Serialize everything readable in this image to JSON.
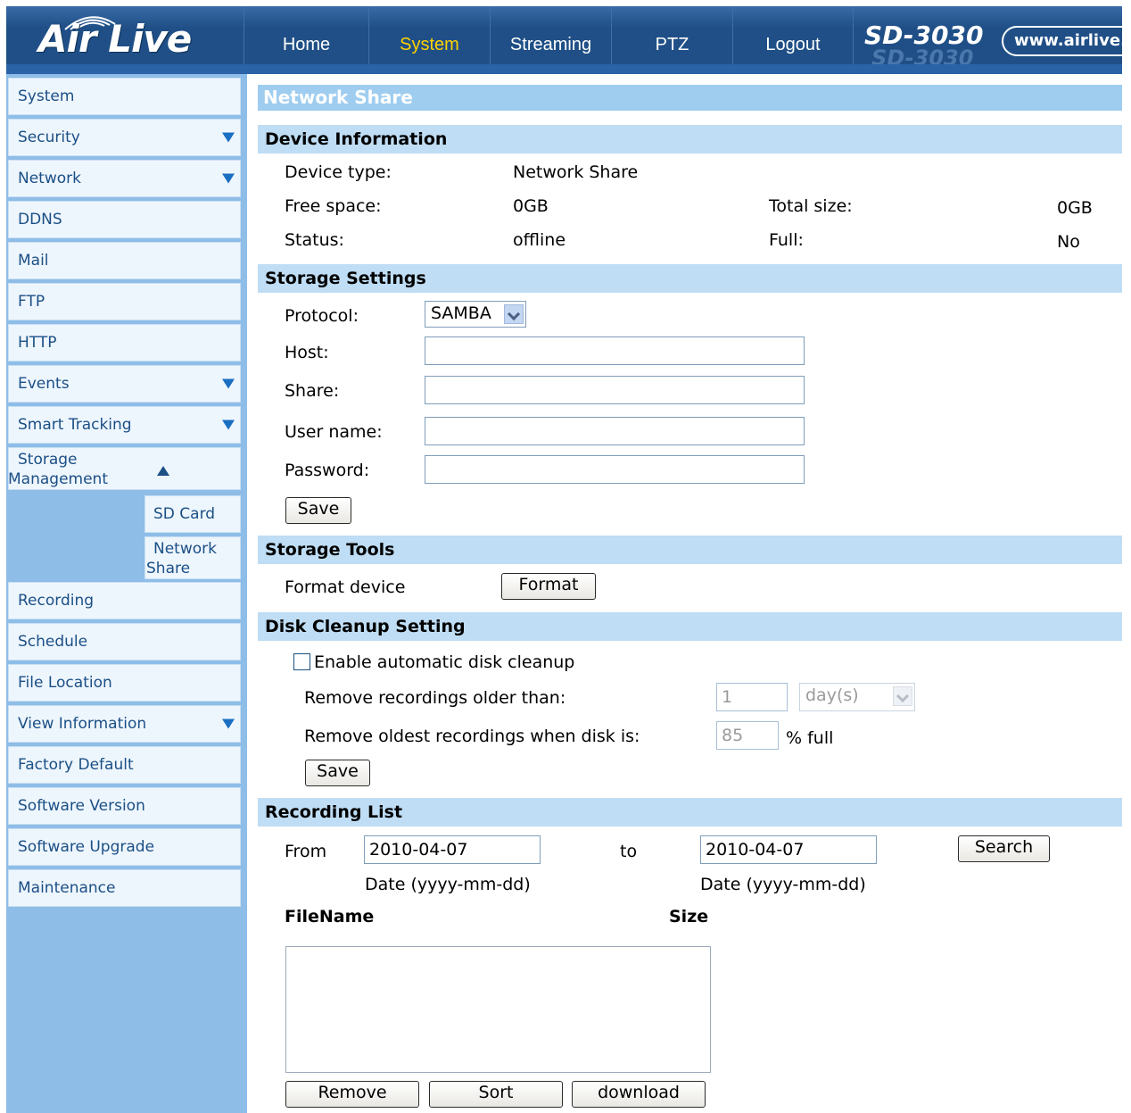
{
  "brand": {
    "logo": "Air Live",
    "model": "SD-3030",
    "url": "www.airlive.c"
  },
  "nav": [
    {
      "label": "Home",
      "active": false
    },
    {
      "label": "System",
      "active": true
    },
    {
      "label": "Streaming",
      "active": false
    },
    {
      "label": "PTZ",
      "active": false
    },
    {
      "label": "Logout",
      "active": false
    }
  ],
  "sidebar": {
    "items": [
      {
        "label": "System"
      },
      {
        "label": "Security",
        "arrow": "down"
      },
      {
        "label": "Network",
        "arrow": "down"
      },
      {
        "label": "DDNS"
      },
      {
        "label": "Mail"
      },
      {
        "label": "FTP"
      },
      {
        "label": "HTTP"
      },
      {
        "label": "Events",
        "arrow": "down"
      },
      {
        "label": "Smart Tracking",
        "arrow": "down"
      },
      {
        "label_line1": "Storage",
        "label_line2": "Management",
        "arrow": "up"
      },
      {
        "label": "Recording"
      },
      {
        "label": "Schedule"
      },
      {
        "label": "File Location"
      },
      {
        "label": "View Information",
        "arrow": "down"
      },
      {
        "label": "Factory Default"
      },
      {
        "label": "Software Version"
      },
      {
        "label": "Software Upgrade"
      },
      {
        "label": "Maintenance"
      }
    ],
    "subitems": [
      {
        "label": "SD Card"
      },
      {
        "label_line1": "Network",
        "label_line2": "Share"
      }
    ]
  },
  "page": {
    "title": "Network Share"
  },
  "device_info": {
    "heading": "Device Information",
    "device_type_label": "Device type:",
    "device_type_value": "Network Share",
    "free_space_label": "Free space:",
    "free_space_value": "0GB",
    "total_size_label": "Total size:",
    "total_size_value": "0GB",
    "status_label": "Status:",
    "status_value": "offline",
    "full_label": "Full:",
    "full_value": "No"
  },
  "storage_settings": {
    "heading": "Storage Settings",
    "protocol_label": "Protocol:",
    "protocol_value": "SAMBA",
    "host_label": "Host:",
    "host_value": "",
    "share_label": "Share:",
    "share_value": "",
    "username_label": "User name:",
    "username_value": "",
    "password_label": "Password:",
    "password_value": "",
    "save_label": "Save"
  },
  "storage_tools": {
    "heading": "Storage Tools",
    "format_device_label": "Format device",
    "format_button": "Format"
  },
  "disk_cleanup": {
    "heading": "Disk Cleanup Setting",
    "enable_label": "Enable automatic disk cleanup",
    "enabled": false,
    "older_than_label": "Remove recordings older than:",
    "older_than_value": "1",
    "unit_value": "day(s)",
    "oldest_label": "Remove oldest recordings when disk is:",
    "oldest_value": "85",
    "percent_label": "% full",
    "save_label": "Save"
  },
  "recording_list": {
    "heading": "Recording List",
    "from_label": "From",
    "from_value": "2010-04-07",
    "to_label": "to",
    "to_value": "2010-04-07",
    "date_hint": "Date (yyyy-mm-dd)",
    "search_button": "Search",
    "col_filename": "FileName",
    "col_size": "Size",
    "remove_button": "Remove",
    "sort_button": "Sort",
    "download_button": "download"
  }
}
